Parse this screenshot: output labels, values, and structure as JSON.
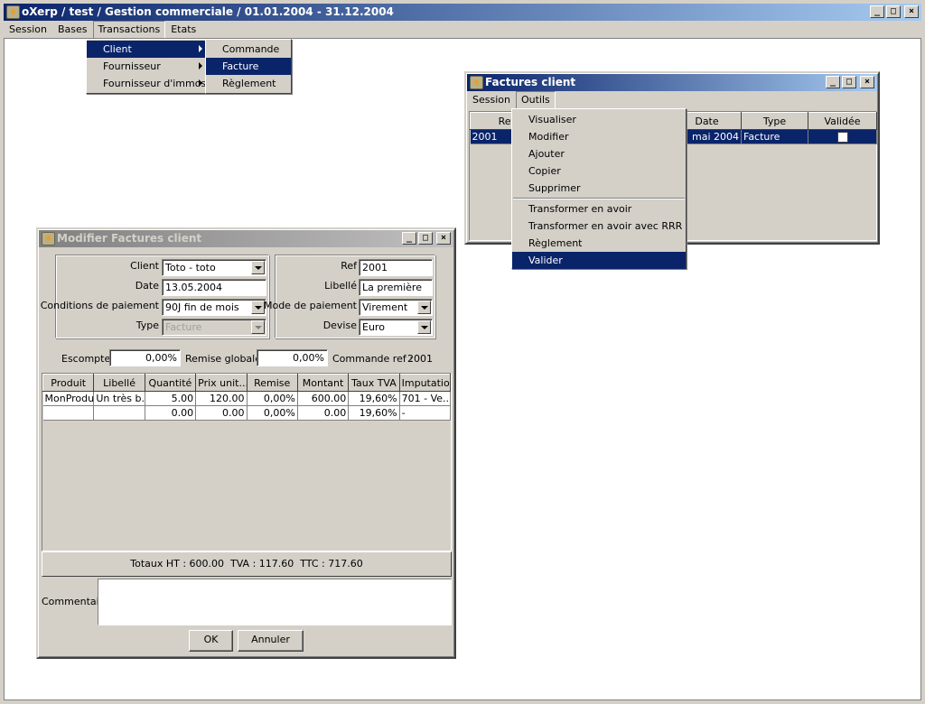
{
  "app": {
    "title": "oXerp / test / Gestion commerciale / 01.01.2004 - 31.12.2004",
    "menu": [
      "Session",
      "Bases",
      "Transactions",
      "Etats"
    ]
  },
  "transactions_menu": {
    "items": [
      "Client",
      "Fournisseur",
      "Fournisseur d'immos"
    ],
    "selected": "Client"
  },
  "client_submenu": {
    "items": [
      "Commande",
      "Facture",
      "Règlement"
    ],
    "selected": "Facture"
  },
  "factures_window": {
    "title": "Factures client",
    "menu": [
      "Session",
      "Outils"
    ],
    "columns": [
      "Ref",
      "Date",
      "Type",
      "Validée"
    ],
    "row": {
      "ref": "2001",
      "date": "mai 2004",
      "type": "Facture",
      "validee": false
    }
  },
  "outils_menu": {
    "items": [
      "Visualiser",
      "Modifier",
      "Ajouter",
      "Copier",
      "Supprimer"
    ],
    "items2": [
      "Transformer en avoir",
      "Transformer en avoir avec RRR",
      "Règlement",
      "Valider"
    ],
    "selected": "Valider"
  },
  "modifier_window": {
    "title": "Modifier Factures client",
    "left": {
      "client_label": "Client",
      "client_value": "Toto - toto",
      "date_label": "Date",
      "date_value": "13.05.2004",
      "conditions_label": "Conditions de paiement",
      "conditions_value": "90J fin de mois",
      "type_label": "Type",
      "type_value": "Facture"
    },
    "right": {
      "ref_label": "Ref",
      "ref_value": "2001",
      "libelle_label": "Libellé",
      "libelle_value": "La première",
      "mode_label": "Mode de paiement",
      "mode_value": "Virement",
      "devise_label": "Devise",
      "devise_value": "Euro"
    },
    "escompte_label": "Escompte",
    "escompte_value": "0,00%",
    "remise_label": "Remise globale",
    "remise_value": "0,00%",
    "commande_label": "Commande ref :",
    "commande_value": "2001",
    "columns": [
      "Produit",
      "Libellé",
      "Quantité",
      "Prix unit...",
      "Remise",
      "Montant",
      "Taux TVA",
      "Imputation"
    ],
    "rows": [
      [
        "MonProduit",
        "Un très b...",
        "5.00",
        "120.00",
        "0,00%",
        "600.00",
        "19,60%",
        "701 - Ve..."
      ],
      [
        "",
        "",
        "0.00",
        "0.00",
        "0,00%",
        "0.00",
        "19,60%",
        "-"
      ]
    ],
    "totals": "Totaux HT : 600.00  TVA : 117.60  TTC : 717.60",
    "commentaire_label": "Commentaire",
    "ok_label": "OK",
    "annuler_label": "Annuler"
  }
}
